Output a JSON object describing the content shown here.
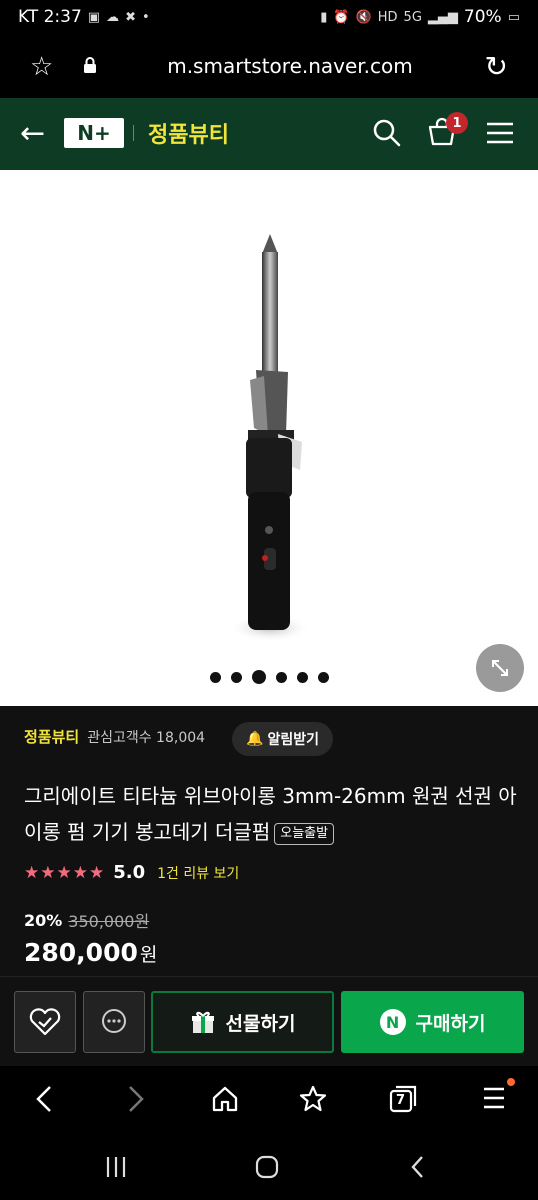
{
  "status": {
    "carrier_time": "KT 2:37",
    "battery": "70%"
  },
  "browser": {
    "url": "m.smartstore.naver.com"
  },
  "header": {
    "logo": "N+",
    "brand": "정품뷰티",
    "cart_count": "1",
    "background": "#0d3b23",
    "accent": "#f1e53b"
  },
  "gallery": {
    "slides": 6,
    "active_index": 2
  },
  "store": {
    "name": "정품뷰티",
    "interest_text": "관심고객수 18,004",
    "alarm_label": "알림받기"
  },
  "product": {
    "title": "그리에이트 티타늄 위브아이롱 3mm-26mm 원권 선권 아이롱 펌 기기 봉고데기 더글펌",
    "badge": "오늘출발",
    "stars": "★★★★★",
    "rating": "5.0",
    "review_link": "1건 리뷰 보기",
    "discount_rate": "20%",
    "original_price": "350,000원",
    "sale_price": "280,000",
    "sale_unit": "원"
  },
  "actions": {
    "gift_label": "선물하기",
    "buy_label": "구매하기",
    "buy_color": "#0aa64b"
  },
  "browser_nav": {
    "tab_count": "7"
  }
}
